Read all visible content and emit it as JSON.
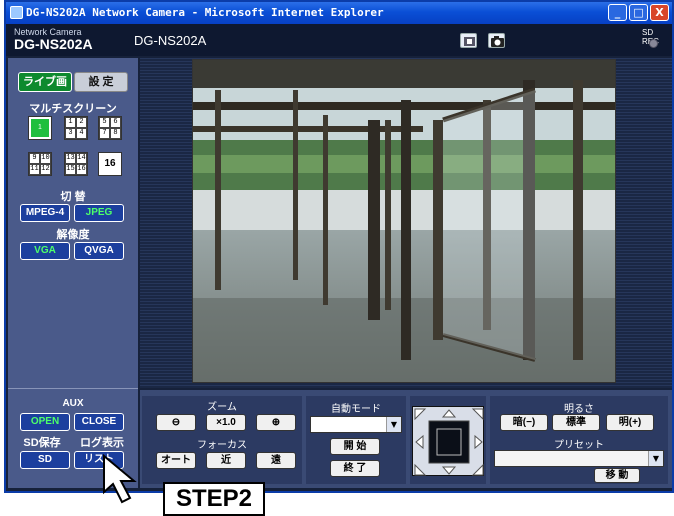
{
  "window": {
    "title": "DG-NS202A Network Camera - Microsoft Internet Explorer",
    "minimize": "_",
    "maximize": "□",
    "close": "X"
  },
  "header": {
    "model_small": "Network Camera",
    "model_big": "DG-NS202A",
    "title": "DG-NS202A",
    "sd_rec": "SD REC"
  },
  "left": {
    "tab_live": "ライブ画",
    "tab_setup": "設 定",
    "multiscreen_label": "マルチスクリーン",
    "screen_1": "1",
    "screen_1_4": [
      "1",
      "2",
      "3",
      "4"
    ],
    "screen_5_8": [
      "5",
      "6",
      "7",
      "8"
    ],
    "screen_9_12": [
      "9",
      "10",
      "11",
      "12"
    ],
    "screen_13_16": [
      "13",
      "14",
      "15",
      "16"
    ],
    "screen_16": "16",
    "switch_label": "切 替",
    "mpeg4": "MPEG-4",
    "jpeg": "JPEG",
    "resolution_label": "解像度",
    "vga": "VGA",
    "qvga": "QVGA",
    "aux_label": "AUX",
    "open": "OPEN",
    "close": "CLOSE",
    "sd_save_label": "SD保存",
    "log_label": "ログ表示",
    "sd": "SD",
    "list": "リスト"
  },
  "controls": {
    "zoom_label": "ズーム",
    "zoom_out": "⊖",
    "zoom_x1": "×1.0",
    "zoom_in": "⊕",
    "focus_label": "フォーカス",
    "focus_auto": "オート",
    "focus_near": "近",
    "focus_far": "遠",
    "auto_mode_label": "自動モード",
    "start": "開 始",
    "stop": "終 了",
    "brightness_label": "明るさ",
    "darker": "暗(−)",
    "standard": "標準",
    "brighter": "明(+)",
    "preset_label": "プリセット",
    "move": "移 動"
  },
  "callout": {
    "text": "STEP2"
  }
}
